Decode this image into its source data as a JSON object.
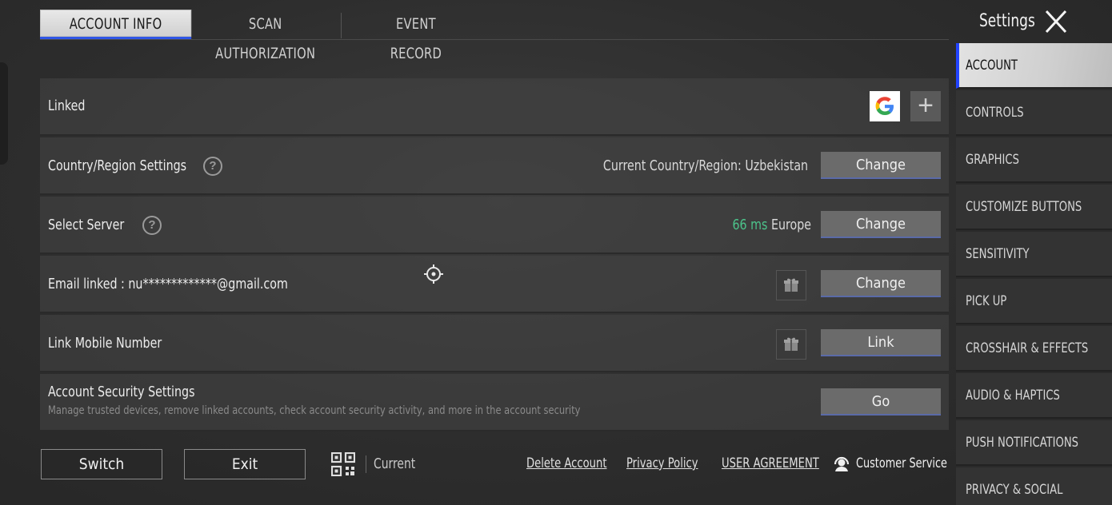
{
  "tabs": [
    {
      "label": "ACCOUNT INFO",
      "active": true
    },
    {
      "label": "SCAN AUTHORIZATION",
      "active": false
    },
    {
      "label": "EVENT RECORD",
      "active": false
    }
  ],
  "settings_title": "Settings",
  "rows": {
    "linked": {
      "label": "Linked"
    },
    "country": {
      "label": "Country/Region Settings",
      "current": "Current Country/Region: Uzbekistan",
      "button": "Change"
    },
    "server": {
      "label": "Select Server",
      "ping": "66 ms",
      "region": "Europe",
      "button": "Change"
    },
    "email": {
      "label": "Email linked : nu*************@gmail.com",
      "button": "Change"
    },
    "mobile": {
      "label": "Link Mobile Number",
      "button": "Link"
    },
    "security": {
      "label": "Account Security Settings",
      "description": "Manage trusted devices, remove linked accounts, check account security activity, and more in the account security",
      "button": "Go"
    }
  },
  "bottom": {
    "switch": "Switch",
    "exit": "Exit",
    "current": "Current",
    "delete_account": "Delete Account",
    "privacy_policy": "Privacy Policy",
    "user_agreement": "USER AGREEMENT",
    "customer_service": "Customer Service"
  },
  "sidebar": {
    "items": [
      {
        "label": "ACCOUNT",
        "active": true
      },
      {
        "label": "CONTROLS"
      },
      {
        "label": "GRAPHICS"
      },
      {
        "label": "CUSTOMIZE BUTTONS"
      },
      {
        "label": "SENSITIVITY"
      },
      {
        "label": "PICK UP"
      },
      {
        "label": "CROSSHAIR & EFFECTS"
      },
      {
        "label": "AUDIO & HAPTICS"
      },
      {
        "label": "PUSH NOTIFICATIONS"
      },
      {
        "label": "PRIVACY & SOCIAL"
      }
    ]
  },
  "colors": {
    "accent": "#2f55e6",
    "ping": "#4cc28a",
    "button": "#6b6b6b"
  },
  "icons": [
    "google-icon",
    "plus-icon",
    "help-icon",
    "gift-icon",
    "qr-code-icon",
    "headset-icon",
    "close-icon",
    "crosshair-icon"
  ]
}
